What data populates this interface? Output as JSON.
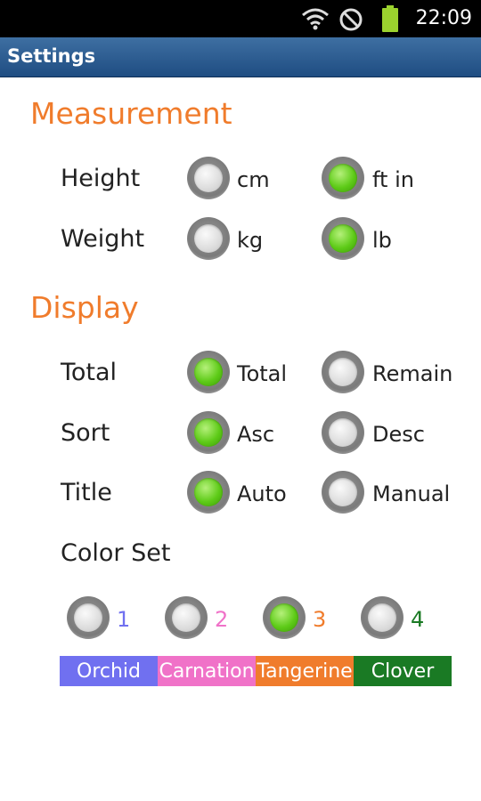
{
  "status_bar": {
    "time": "22:09"
  },
  "app": {
    "title": "Settings"
  },
  "measurement": {
    "title": "Measurement",
    "height": {
      "label": "Height",
      "options": [
        "cm",
        "ft in"
      ],
      "selected": "ft in"
    },
    "weight": {
      "label": "Weight",
      "options": [
        "kg",
        "lb"
      ],
      "selected": "lb"
    }
  },
  "display": {
    "title": "Display",
    "total": {
      "label": "Total",
      "options": [
        "Total",
        "Remain"
      ],
      "selected": "Total"
    },
    "sort": {
      "label": "Sort",
      "options": [
        "Asc",
        "Desc"
      ],
      "selected": "Asc"
    },
    "title_row": {
      "label": "Title",
      "options": [
        "Auto",
        "Manual"
      ],
      "selected": "Auto"
    },
    "color_set": {
      "label": "Color Set",
      "options": [
        {
          "num": "1",
          "name": "Orchid",
          "color": "#7070f0"
        },
        {
          "num": "2",
          "name": "Carnation",
          "color": "#f072c8"
        },
        {
          "num": "3",
          "name": "Tangerine",
          "color": "#f07c2c"
        },
        {
          "num": "4",
          "name": "Clover",
          "color": "#1a7a24"
        }
      ],
      "selected": "3"
    }
  },
  "icons": [
    "wifi-icon",
    "blocked-icon",
    "battery-icon"
  ],
  "colors": {
    "accent": "#f07c2c",
    "radio_checked": "#5ecb18",
    "title_bar": "#2d5f96"
  }
}
